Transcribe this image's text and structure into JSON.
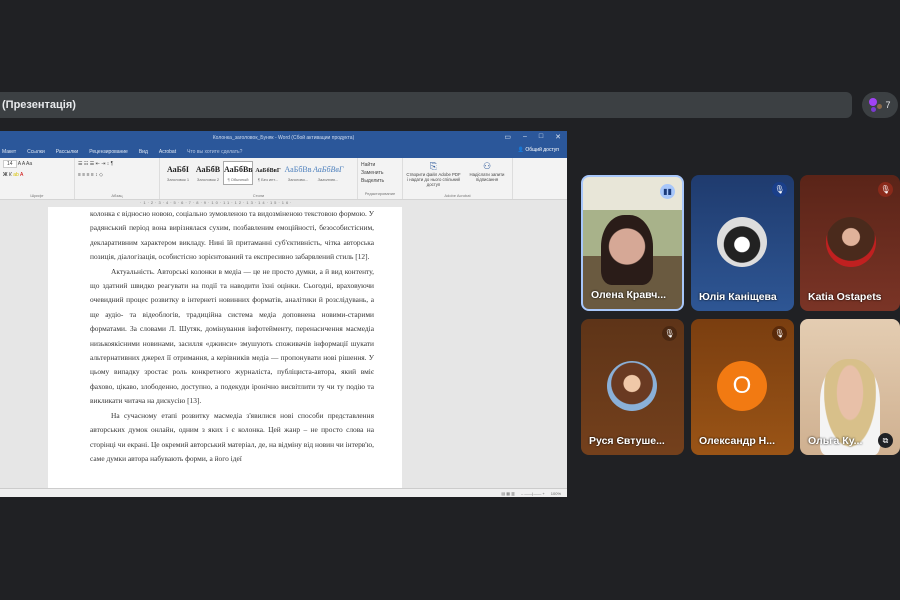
{
  "meet": {
    "presentation_title": "(Презентація)",
    "participant_count": "7"
  },
  "word": {
    "title": "Колонка_заголовок_Буняк - Word (Сбой активации продукта)",
    "share": "Общий доступ",
    "tabs": [
      "Макет",
      "Ссылки",
      "Рассылки",
      "Рецензирование",
      "Вид",
      "Acrobat",
      "Что вы хотите сделать?"
    ],
    "font_size": "14",
    "styles": [
      {
        "sample": "АаБбІ",
        "label": "Заголовок 1"
      },
      {
        "sample": "АаБбВ",
        "label": "Заголовок 2"
      },
      {
        "sample": "АаБбВв",
        "label": "¶ Обычный"
      },
      {
        "sample": "АаБбВвГ",
        "label": "¶ Без инт..."
      },
      {
        "sample": "АаБбВв",
        "label": "Заголово..."
      },
      {
        "sample": "АаБбВвГ",
        "label": "Заголово..."
      }
    ],
    "edit": [
      "Найти",
      "Заменить",
      "Выделить"
    ],
    "acrobat": [
      "Створити файл Adobe PDF і надати до нього спільний доступ",
      "Надіслати запити підписання"
    ],
    "groups": [
      "Шрифт",
      "Абзац",
      "Стили",
      "Редактирование",
      "Adobe Acrobat"
    ],
    "zoom": "100%",
    "paragraphs": [
      "колонка є відносно новою, соціально зумовленою та видозміненою текстовою формою. У радянський період вона вирізнялася сухим, позбавленим емоційності, безособистісним, декларативним характером викладу. Нині їй притаманні суб'єктивність, чітка авторська позиція, діалогізація, особистісно зорієнтований та експресивно забарвлений стиль [12].",
      "Актуальність. Авторські колонки в медіа — це не просто думки, а й вид контенту, що здатний швидко реагувати на події та наводити їхні оцінки. Сьогодні, враховуючи очевидний процес розвитку в інтернеті новинних форматів, аналітики й розслідувань, а ще аудіо- та відеоблогів, традиційна система медіа доповнена новими-старими форматами. За словами Л. Шутяк, домінування інфотейменту, перенасичення масмедіа низькоякісними новинами, засилля «джинси» змушують споживачів інформації шукати альтернативних джерел її отримання, а керівників медіа — пропонувати нові рішення. У цьому випадку зростає роль конкретного журналіста, публіциста-автора, який вміє фахово, цікаво, злободенно, доступно, а подекуди іронічно висвітлити ту чи ту подію та викликати читача на дискусію [13].",
      "На сучасному етапі розвитку масмедіа з'явилися нові способи представлення авторських думок онлайн, одним з яких і є колонка. Цей жанр – не просто слова на сторінці чи екрані. Це окремий авторський матеріал, де, на відміну від новин чи інтерв'ю, саме думки автора набувають форми, а його ідеї"
    ]
  },
  "participants": [
    {
      "name": "Олена Кравч...",
      "state": "speaking",
      "bg": "#7a8a6a"
    },
    {
      "name": "Юлія Каніщева",
      "state": "muted",
      "bg": "#2b4a80"
    },
    {
      "name": "Katia Ostapets",
      "state": "muted",
      "bg": "#6b2e20"
    },
    {
      "name": "Руся Євтуше...",
      "state": "muted",
      "bg": "#6a3a1c"
    },
    {
      "name": "Олександр Н...",
      "state": "muted",
      "bg": "#8a4a14",
      "initial": "O"
    },
    {
      "name": "Ольга Ку...",
      "state": "pinned",
      "bg": "#d8c0a4"
    }
  ]
}
